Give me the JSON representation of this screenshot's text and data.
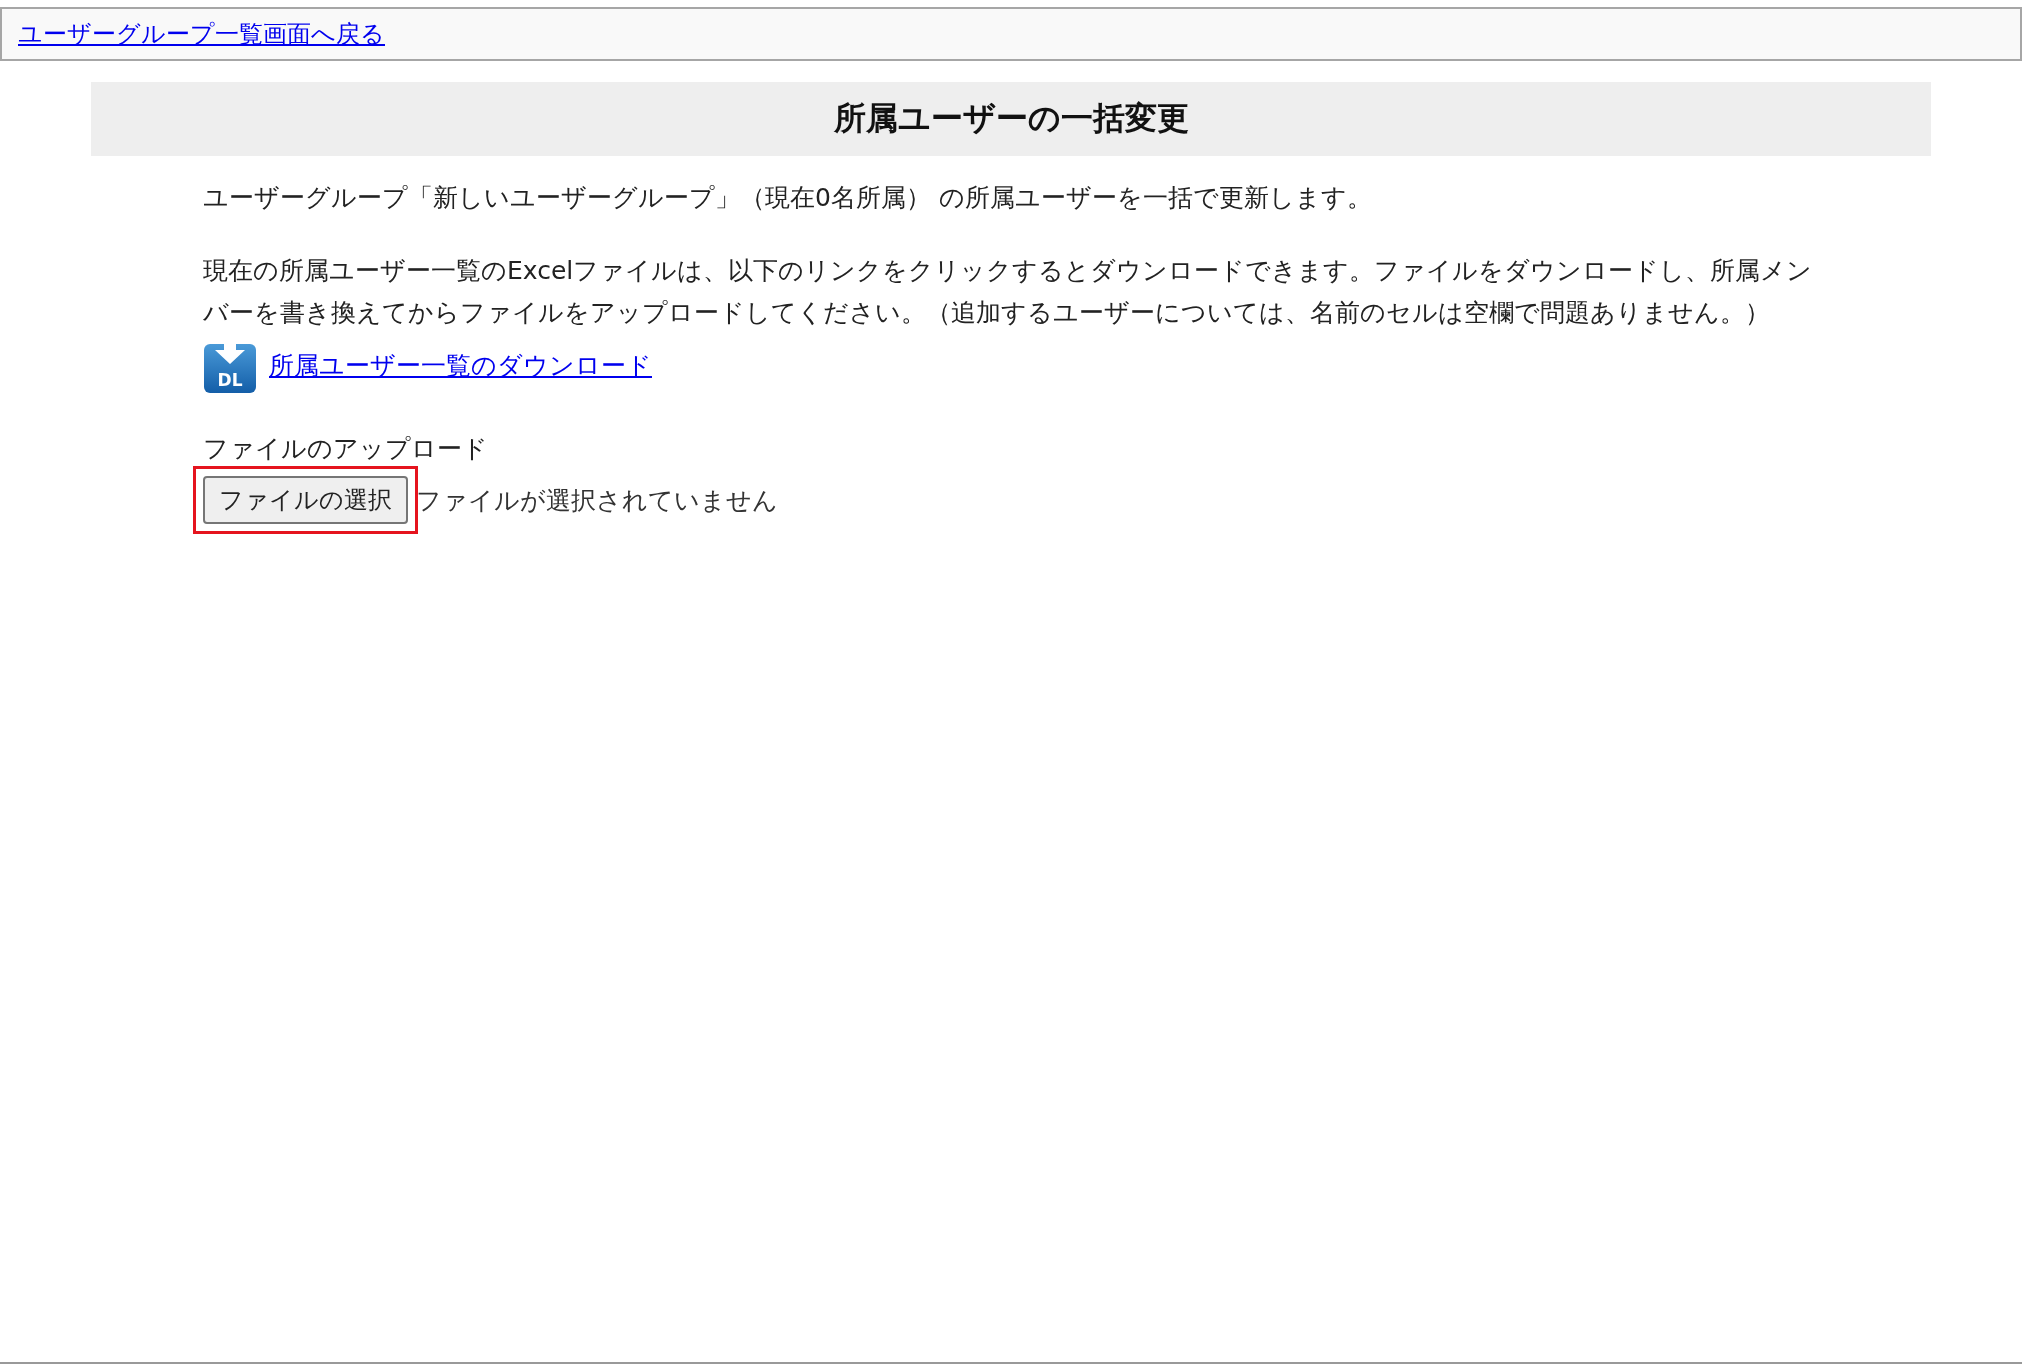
{
  "back_link": "ユーザーグループ一覧画面へ戻る",
  "title": "所属ユーザーの一括変更",
  "intro": "ユーザーグループ「新しいユーザーグループ」（現在0名所属） の所属ユーザーを一括で更新します。",
  "instructions": "現在の所属ユーザー一覧のExcelファイルは、以下のリンクをクリックするとダウンロードできます。ファイルをダウンロードし、所属メンバーを書き換えてからファイルをアップロードしてください。（追加するユーザーについては、名前のセルは空欄で問題ありません。）",
  "download": {
    "icon_text": "DL",
    "label": "所属ユーザー一覧のダウンロード"
  },
  "upload": {
    "label": "ファイルのアップロード",
    "button": "ファイルの選択",
    "status": "ファイルが選択されていません",
    "highlighted": true
  }
}
